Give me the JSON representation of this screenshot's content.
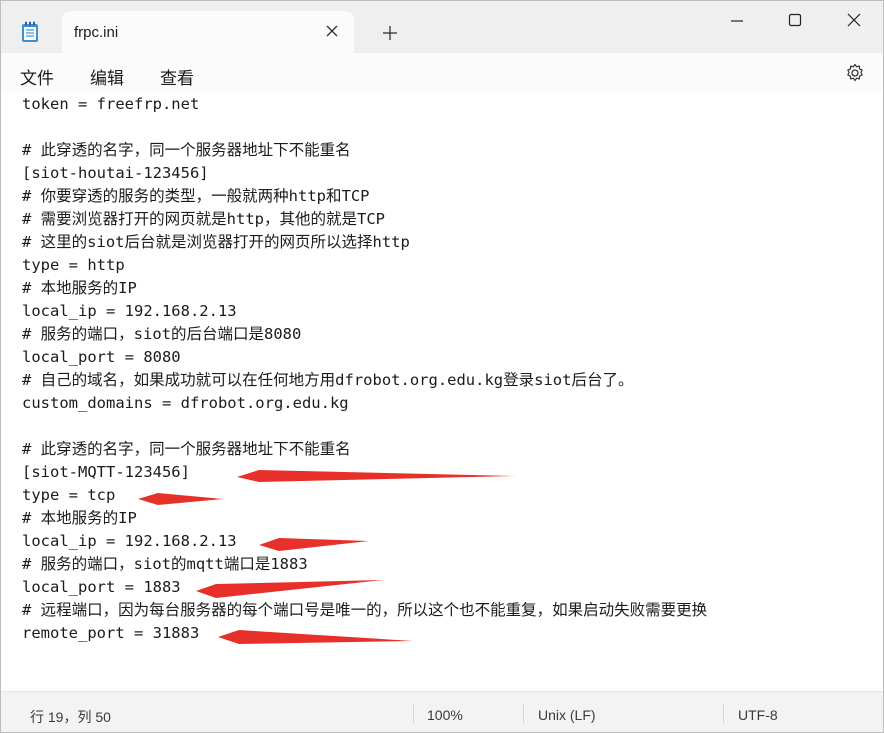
{
  "tab": {
    "title": "frpc.ini"
  },
  "menu": {
    "file": "文件",
    "edit": "编辑",
    "view": "查看"
  },
  "icons": {
    "app": "notepad-icon",
    "close_tab": "close-icon",
    "new_tab": "plus-icon",
    "minimize": "minimize-icon",
    "maximize": "maximize-icon",
    "close_window": "close-icon",
    "settings": "gear-icon"
  },
  "editor": {
    "lines": [
      "token = freefrp.net",
      "",
      "# 此穿透的名字，同一个服务器地址下不能重名",
      "[siot-houtai-123456]",
      "# 你要穿透的服务的类型，一般就两种http和TCP",
      "# 需要浏览器打开的网页就是http，其他的就是TCP",
      "# 这里的siot后台就是浏览器打开的网页所以选择http",
      "type = http",
      "# 本地服务的IP",
      "local_ip = 192.168.2.13",
      "# 服务的端口，siot的后台端口是8080",
      "local_port = 8080",
      "# 自己的域名，如果成功就可以在任何地方用dfrobot.org.edu.kg登录siot后台了。",
      "custom_domains = dfrobot.org.edu.kg",
      "",
      "# 此穿透的名字，同一个服务器地址下不能重名",
      "[siot-MQTT-123456]",
      "type = tcp",
      "# 本地服务的IP",
      "local_ip = 192.168.2.13",
      "# 服务的端口，siot的mqtt端口是1883",
      "local_port = 1883",
      "# 远程端口，因为每台服务器的每个端口号是唯一的，所以这个也不能重复，如果启动失败需要更换",
      "remote_port = 31883"
    ],
    "annotation_color": "#e8302a"
  },
  "status": {
    "position": "行 19，列 50",
    "zoom": "100%",
    "line_ending": "Unix (LF)",
    "encoding": "UTF-8"
  }
}
